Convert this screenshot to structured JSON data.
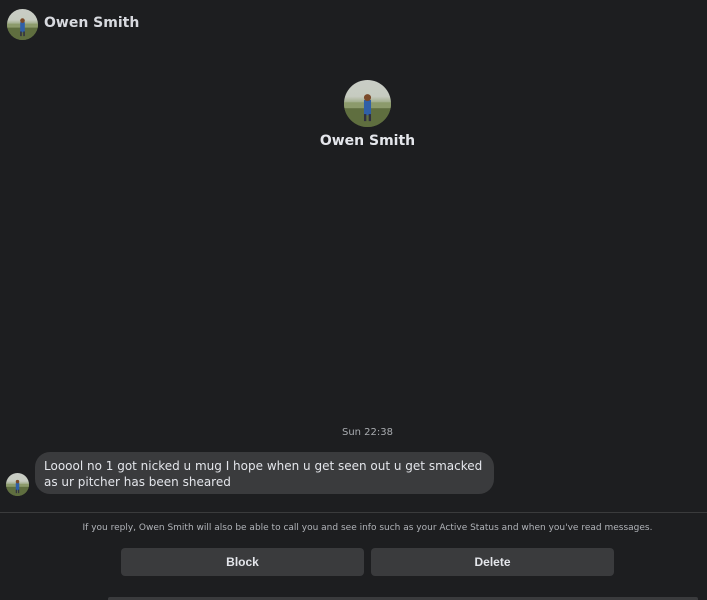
{
  "header": {
    "name": "Owen Smith"
  },
  "profile": {
    "name": "Owen Smith"
  },
  "conversation": {
    "timestamp": "Sun 22:38",
    "messages": [
      {
        "text": "Looool no 1 got nicked u mug I hope when u get seen out u get smacked as ur pitcher has been sheared"
      }
    ]
  },
  "request": {
    "notice": "If you reply, Owen Smith will also be able to call you and see info such as your Active Status and when you've read messages.",
    "block_label": "Block",
    "delete_label": "Delete"
  },
  "colors": {
    "background": "#1d1e20",
    "bubble": "#3a3b3d",
    "button": "#3a3b3d",
    "text": "#e4e6eb"
  }
}
